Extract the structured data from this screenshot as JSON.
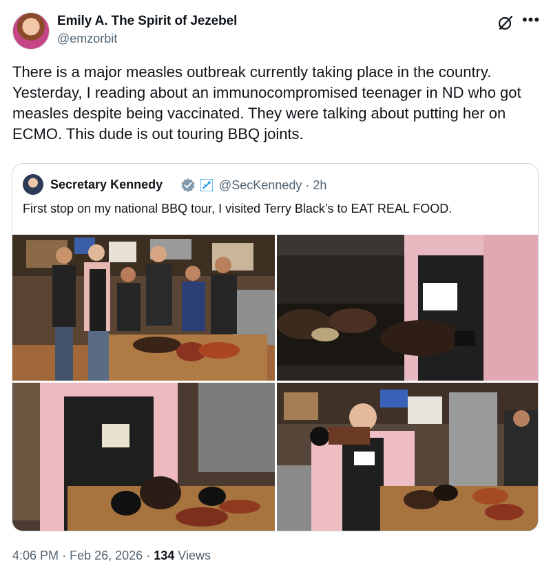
{
  "author": {
    "name": "Emily A. The Spirit of Jezebel",
    "handle": "@emzorbit"
  },
  "tweet": {
    "text": "There is a major measles outbreak currently taking place in the country. Yesterday, I reading about an immunocompromised teenager in ND who got measles despite being vaccinated. They were talking about putting her on ECMO. This dude is out touring BBQ joints."
  },
  "icons": {
    "grok": "grok-icon",
    "more": "more-icon",
    "verified": "verified-badge-icon",
    "government": "government-affiliation-icon"
  },
  "quote": {
    "name": "Secretary Kennedy",
    "handle": "@SecKennedy",
    "separator": "·",
    "time": "2h",
    "text": "First stop on my national BBQ tour, I visited Terry Black’s to EAT REAL FOOD.",
    "photos": [
      {
        "name": "group-photo"
      },
      {
        "name": "smoker-photo"
      },
      {
        "name": "cutting-board-photo"
      },
      {
        "name": "holding-brisket-photo"
      }
    ],
    "apron_logo_text": "TERRY BLACK'S BBQ"
  },
  "meta": {
    "time": "4:06 PM",
    "separator": "·",
    "date": "Feb 26, 2026",
    "views_count": "134",
    "views_label": "Views"
  },
  "colors": {
    "text": "#0f1419",
    "secondary": "#536471",
    "border": "#cfd9de",
    "verified": "#829aab",
    "gov_badge": "#1d9bf0"
  }
}
